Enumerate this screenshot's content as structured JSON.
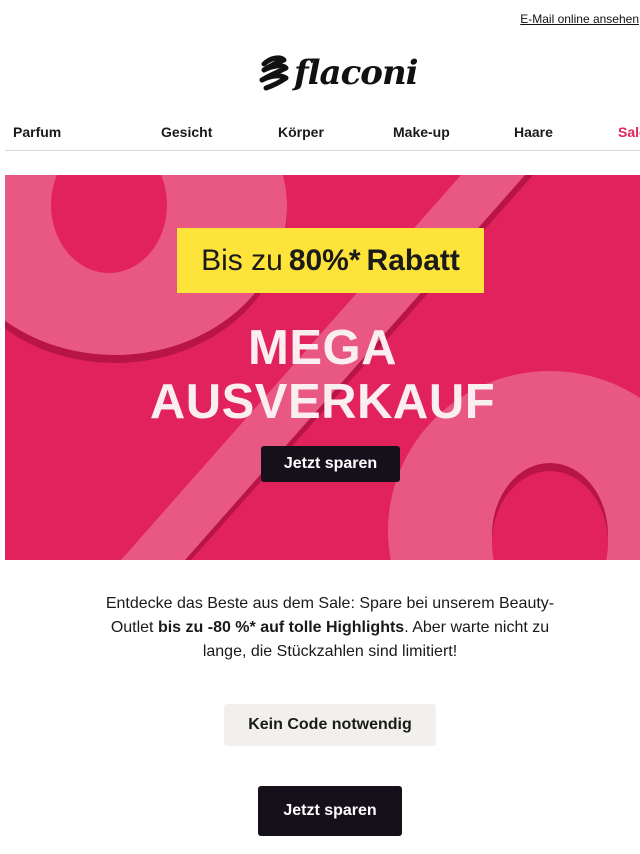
{
  "header": {
    "view_online_link": "E-Mail online ansehen",
    "logo_text": "flaconi"
  },
  "nav": {
    "items": [
      {
        "label": "Parfum"
      },
      {
        "label": "Gesicht"
      },
      {
        "label": "Körper"
      },
      {
        "label": "Make-up"
      },
      {
        "label": "Haare"
      },
      {
        "label": "Sale"
      }
    ]
  },
  "hero": {
    "badge_prefix": "Bis zu",
    "badge_value": "80%*",
    "badge_suffix": "Rabatt",
    "title_line1": "MEGA",
    "title_line2": "AUSVERKAUF",
    "button_label": "Jetzt sparen",
    "colors": {
      "background": "#e1225d",
      "badge": "#fde33a",
      "percent_shape": "#e85882"
    }
  },
  "intro": {
    "text_before": "Entdecke das Beste aus dem Sale: Spare bei unserem Beauty-Outlet ",
    "text_bold": "bis zu -80 %* auf tolle Highlights",
    "text_after": ". Aber warte nicht zu lange, die Stückzahlen sind limitiert!"
  },
  "code_button": {
    "label": "Kein Code notwendig"
  },
  "cta_button": {
    "label": "Jetzt sparen"
  },
  "colors": {
    "accent_sale": "#e0245e",
    "button_dark": "#15101a",
    "code_bg": "#f2f0ec"
  }
}
